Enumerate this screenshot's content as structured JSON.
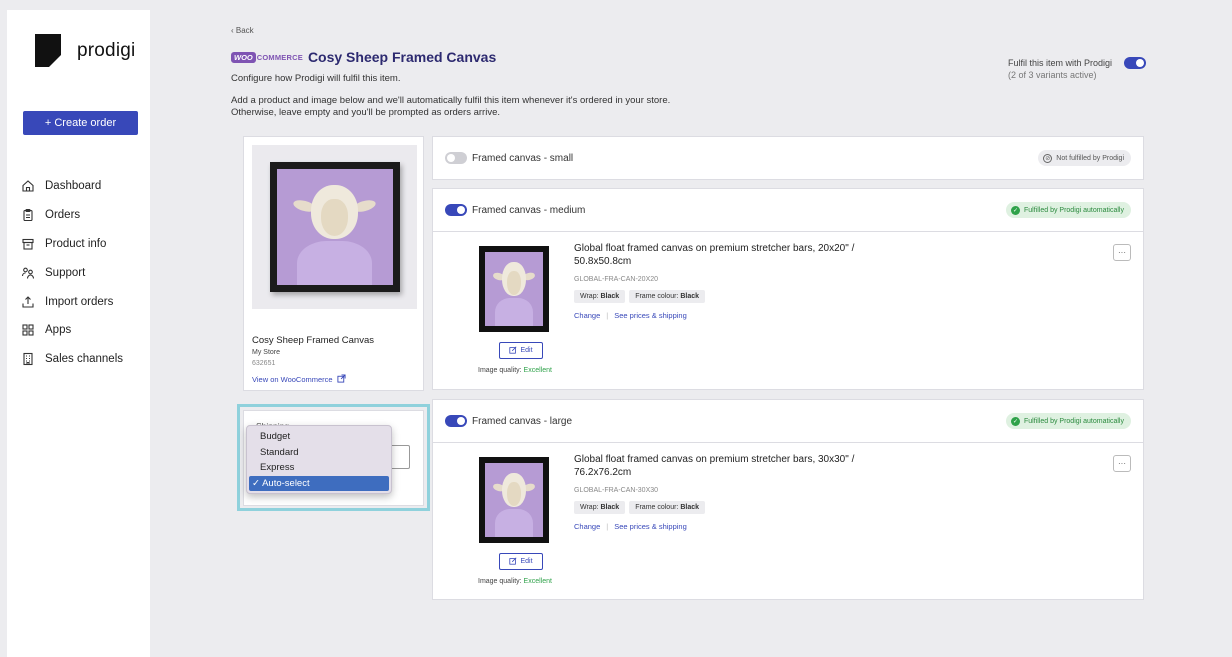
{
  "brand": {
    "name": "prodigi"
  },
  "sidebar": {
    "create_label": "+ Create order",
    "items": [
      {
        "label": "Dashboard",
        "icon": "home-icon"
      },
      {
        "label": "Orders",
        "icon": "clipboard-icon"
      },
      {
        "label": "Product info",
        "icon": "box-icon"
      },
      {
        "label": "Support",
        "icon": "people-icon"
      },
      {
        "label": "Import orders",
        "icon": "upload-icon"
      },
      {
        "label": "Apps",
        "icon": "grid-icon"
      },
      {
        "label": "Sales channels",
        "icon": "building-icon"
      }
    ]
  },
  "header": {
    "back": "‹ Back",
    "woo_badge": "WOO",
    "commerce_badge": "COMMERCE",
    "title": "Cosy Sheep Framed Canvas",
    "subtitle": "Configure how Prodigi will fulfil this item.",
    "desc_line1": "Add a product and image below and we'll automatically fulfil this item whenever it's ordered in your store.",
    "desc_line2": "Otherwise, leave empty and you'll be prompted as orders arrive.",
    "fulfil_label": "Fulfil this item with Prodigi",
    "fulfil_sub": "(2 of 3 variants active)",
    "fulfil_enabled": true
  },
  "product": {
    "name": "Cosy Sheep Framed Canvas",
    "store": "My Store",
    "id": "632651",
    "link": "View on WooCommerce"
  },
  "shipping": {
    "label": "Shipping",
    "options": [
      "Budget",
      "Standard",
      "Express",
      "Auto-select"
    ],
    "selected": "✓ Auto-select"
  },
  "variants": [
    {
      "name": "Framed canvas - small",
      "enabled": false,
      "status": "Not fulfilled by Prodigi"
    },
    {
      "name": "Framed canvas - medium",
      "enabled": true,
      "status": "Fulfilled by Prodigi automatically",
      "product_title_1": "Global float framed canvas on premium stretcher bars, 20x20\" /",
      "product_title_2": "50.8x50.8cm",
      "sku": "GLOBAL-FRA-CAN-20X20",
      "wrap_label": "Wrap:",
      "wrap_value": "Black",
      "frame_label": "Frame colour:",
      "frame_value": "Black",
      "change": "Change",
      "prices": "See prices & shipping",
      "edit": "Edit",
      "quality_label": "Image quality:",
      "quality_value": "Excellent",
      "more": "···"
    },
    {
      "name": "Framed canvas - large",
      "enabled": true,
      "status": "Fulfilled by Prodigi automatically",
      "product_title_1": "Global float framed canvas on premium stretcher bars, 30x30\" /",
      "product_title_2": "76.2x76.2cm",
      "sku": "GLOBAL-FRA-CAN-30X30",
      "wrap_label": "Wrap:",
      "wrap_value": "Black",
      "frame_label": "Frame colour:",
      "frame_value": "Black",
      "change": "Change",
      "prices": "See prices & shipping",
      "edit": "Edit",
      "quality_label": "Image quality:",
      "quality_value": "Excellent",
      "more": "···"
    }
  ],
  "colors": {
    "accent": "#3848b9",
    "success": "#2fa24a",
    "woo": "#7f54b3"
  }
}
